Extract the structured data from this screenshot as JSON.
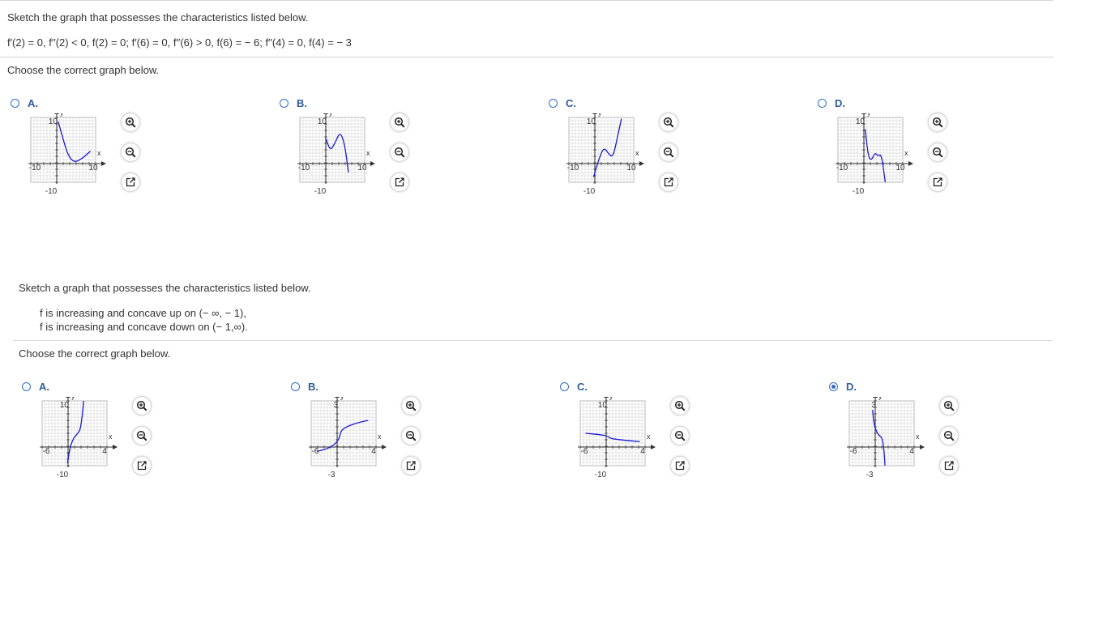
{
  "q1": {
    "prompt": "Sketch the graph that possesses the characteristics listed below.",
    "conditions": "f′(2) = 0, f′′(2) < 0, f(2) = 0; f′(6) = 0, f′′(6) > 0, f(6) = − 6; f′′(4) = 0, f(4) = − 3",
    "choose": "Choose the correct graph below.",
    "options": [
      {
        "letter": "A.",
        "selected": false,
        "xlabel": "x",
        "ylabel": "y",
        "ticks": [
          "10",
          "-10",
          "10",
          "-10"
        ]
      },
      {
        "letter": "B.",
        "selected": false,
        "xlabel": "x",
        "ylabel": "y",
        "ticks": [
          "10",
          "-10",
          "10",
          "-10"
        ]
      },
      {
        "letter": "C.",
        "selected": false,
        "xlabel": "x",
        "ylabel": "y",
        "ticks": [
          "10",
          "-10",
          "10",
          "-10"
        ]
      },
      {
        "letter": "D.",
        "selected": false,
        "xlabel": "x",
        "ylabel": "y",
        "ticks": [
          "10",
          "-10",
          "10",
          "-10"
        ]
      }
    ]
  },
  "q2": {
    "prompt": "Sketch a graph that possesses the characteristics listed below.",
    "line1": "f is increasing and concave up on (− ∞, − 1),",
    "line2": "f is increasing and concave down on (− 1,∞).",
    "choose": "Choose the correct graph below.",
    "options": [
      {
        "letter": "A.",
        "selected": false,
        "xlabel": "x",
        "ylabel": "y",
        "ticks": [
          "10",
          "-6",
          "4",
          "-10"
        ]
      },
      {
        "letter": "B.",
        "selected": false,
        "xlabel": "x",
        "ylabel": "y",
        "ticks": [
          "3",
          "-6",
          "4",
          "-3"
        ]
      },
      {
        "letter": "C.",
        "selected": false,
        "xlabel": "x",
        "ylabel": "y",
        "ticks": [
          "10",
          "-6",
          "4",
          "-10"
        ]
      },
      {
        "letter": "D.",
        "selected": true,
        "xlabel": "x",
        "ylabel": "y",
        "ticks": [
          "3",
          "-6",
          "4",
          "-3"
        ]
      }
    ]
  },
  "colors": {
    "curve": "#1a1ad6",
    "accent": "#2f6ccd",
    "rule": "#d6d6d6"
  },
  "buttons": [
    "zoom-in-icon",
    "zoom-out-icon",
    "open-external-icon"
  ]
}
